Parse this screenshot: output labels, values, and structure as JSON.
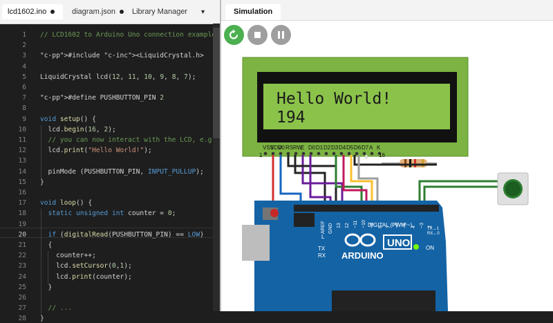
{
  "tabs": [
    {
      "label": "lcd1602.ino",
      "modified": true
    },
    {
      "label": "diagram.json",
      "modified": true
    },
    {
      "label": "Library Manager"
    }
  ],
  "code_lines": [
    "// LCD1602 to Arduino Uno connection example",
    "",
    "#include <LiquidCrystal.h>",
    "",
    "LiquidCrystal lcd(12, 11, 10, 9, 8, 7);",
    "",
    "#define PUSHBUTTON_PIN 2",
    "",
    "void setup() {",
    "  lcd.begin(16, 2);",
    "  // you can now interact with the LCD, e.g.:",
    "  lcd.print(\"Hello World!\");",
    "",
    "  pinMode (PUSHBUTTON_PIN, INPUT_PULLUP);",
    "}",
    "",
    "void loop() {",
    "  static unsigned int counter = 0;",
    "",
    "  if (digitalRead(PUSHBUTTON_PIN) == LOW)",
    "  {",
    "    counter++;",
    "    lcd.setCursor(0,1);",
    "    lcd.print(counter);",
    "  }",
    "",
    "  // ...",
    "}"
  ],
  "current_line": 20,
  "simulation": {
    "tab_label": "Simulation",
    "controls": {
      "restart_icon": "restart-icon",
      "stop_icon": "stop-icon",
      "pause_icon": "pause-icon"
    },
    "lcd": {
      "line1": "Hello World!",
      "line2": "194",
      "pins": [
        "VSS",
        "VDD",
        "V0",
        "RS",
        "RW",
        "E",
        "D0",
        "D1",
        "D2",
        "D3",
        "D4",
        "D5",
        "D6",
        "D7",
        "A",
        "K"
      ],
      "pin_first": "1",
      "pin_last": "16"
    },
    "arduino": {
      "brand": "ARDUINO",
      "model": "UNO",
      "labels": {
        "aref": "AREF",
        "gnd": "GND",
        "digital": "DIGITAL (PWM ~)",
        "l": "L",
        "tx": "TX",
        "rx": "RX",
        "on": "ON",
        "tx1": "TX→1",
        "rx0": "RX←0"
      },
      "pin_numbers": [
        "13",
        "12",
        "~11",
        "~10",
        "~9",
        "8",
        "7",
        "~6",
        "~5",
        "4",
        "~3",
        "2"
      ]
    }
  },
  "colors": {
    "accent_green": "#4caf50",
    "lcd_bg": "#8bc34a",
    "board": "#1463a5"
  }
}
